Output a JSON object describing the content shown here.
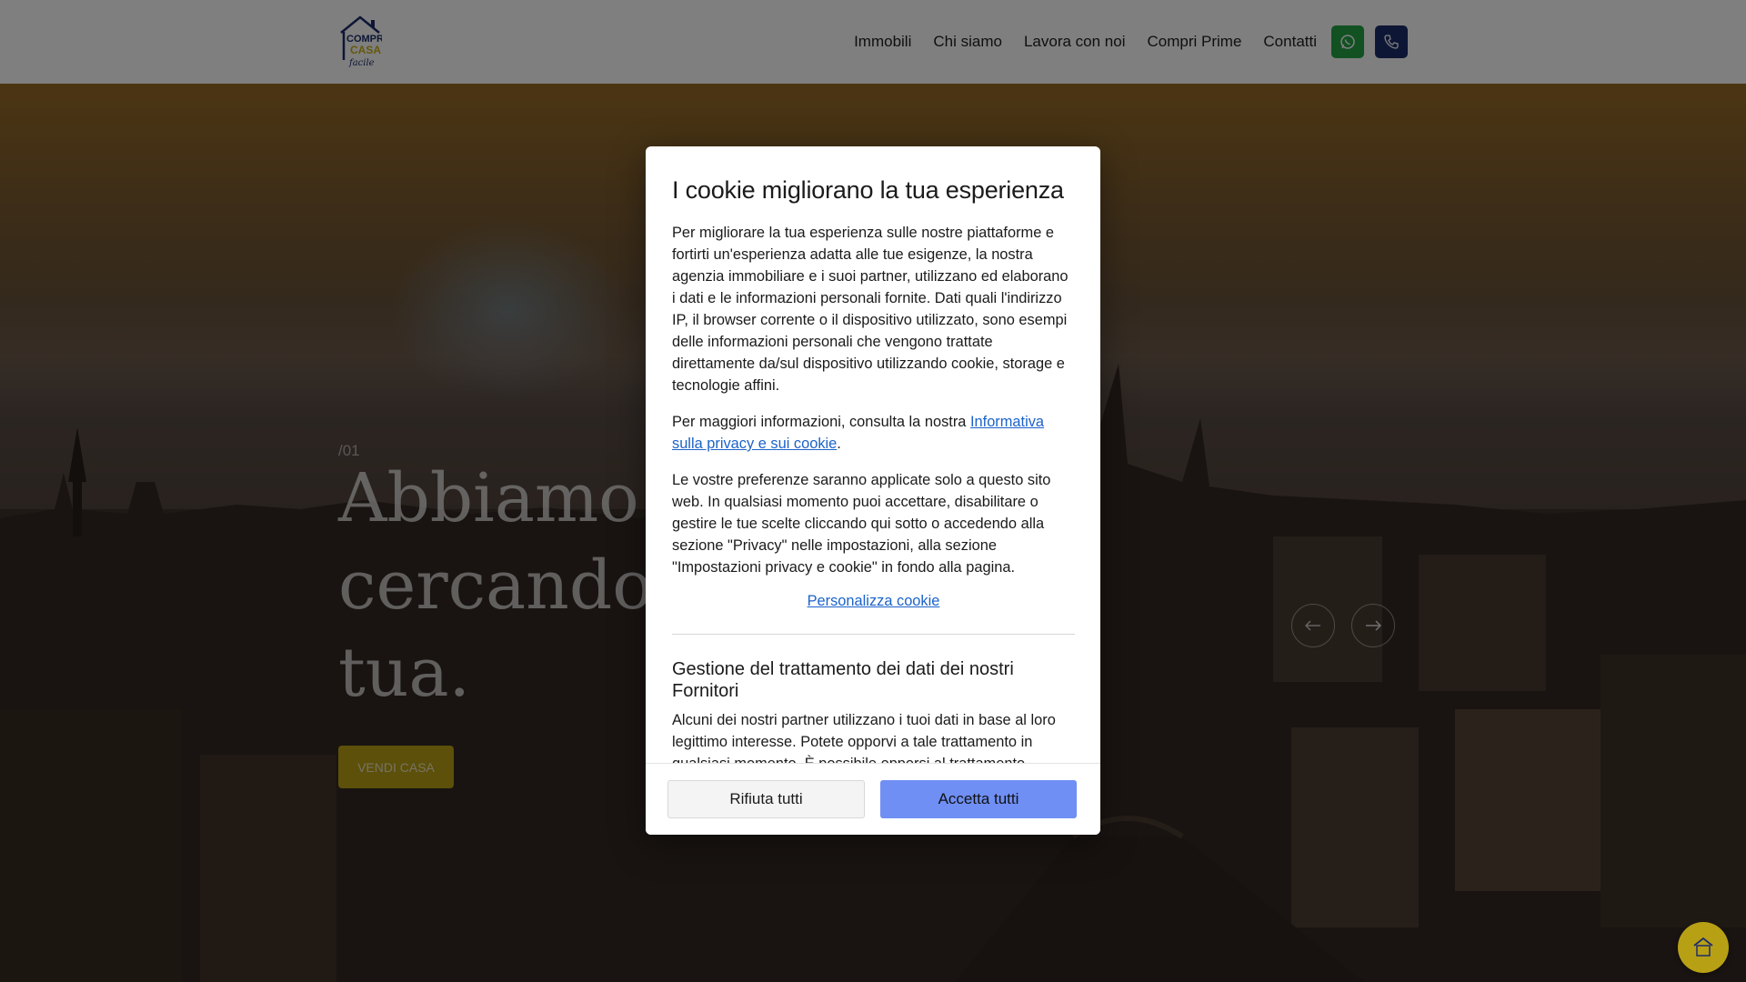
{
  "header": {
    "logo_text": [
      "COMPRI",
      "CASA",
      "facile"
    ],
    "nav": [
      "Immobili",
      "Chi siamo",
      "Lavora con noi",
      "Compri Prime",
      "Contatti"
    ]
  },
  "hero": {
    "slide_index": "/01",
    "title_lines": [
      "Abbiamo g",
      "cercando ca",
      "tua."
    ],
    "cta_label": "VENDI CASA"
  },
  "cookie_modal": {
    "title": "I cookie migliorano la tua esperienza",
    "para1": "Per migliorare la tua esperienza sulle nostre piattaforme e fortirti un'esperienza adatta alle tue esigenze, la nostra agenzia immobiliare e i suoi partner, utilizzano ed elaborano i dati e le informazioni personali fornite. Dati quali l'indirizzo IP, il browser corrente o il dispositivo utilizzato, sono esempi delle informazioni personali che vengono trattate direttamente da/sul dispositivo utilizzando cookie, storage e tecnologie affini.",
    "para2_prefix": "Per maggiori informazioni, consulta la nostra ",
    "para2_link": "Informativa sulla privacy e sui cookie",
    "para2_suffix": ".",
    "para3": "Le vostre preferenze saranno applicate solo a questo sito web. In qualsiasi momento puoi accettare, disabilitare o gestire le tue scelte cliccando qui sotto o accedendo alla sezione \"Privacy\" nelle impostazioni, alla sezione \"Impostazioni privacy e cookie\" in fondo alla pagina.",
    "personalize_link": "Personalizza cookie",
    "section_title": "Gestione del trattamento dei dati dei nostri Fornitori",
    "section_text": "Alcuni dei nostri partner utilizzano i tuoi dati in base al loro legittimo interesse. Potete opporvi a tale trattamento in qualsiasi momento. È possibile opporsi al trattamento",
    "reject_label": "Rifiuta tutti",
    "accept_label": "Accetta tutti"
  },
  "colors": {
    "cta_gold": "#b8a015",
    "whatsapp_green": "#25a244",
    "phone_navy": "#1d2d6b",
    "accept_blue": "#6f8ff5",
    "link_blue": "#1c63c9"
  },
  "icons": {
    "whatsapp": "whatsapp-icon",
    "phone": "phone-icon",
    "prev": "arrow-left-icon",
    "next": "arrow-right-icon",
    "chat": "chat-logo-icon"
  }
}
